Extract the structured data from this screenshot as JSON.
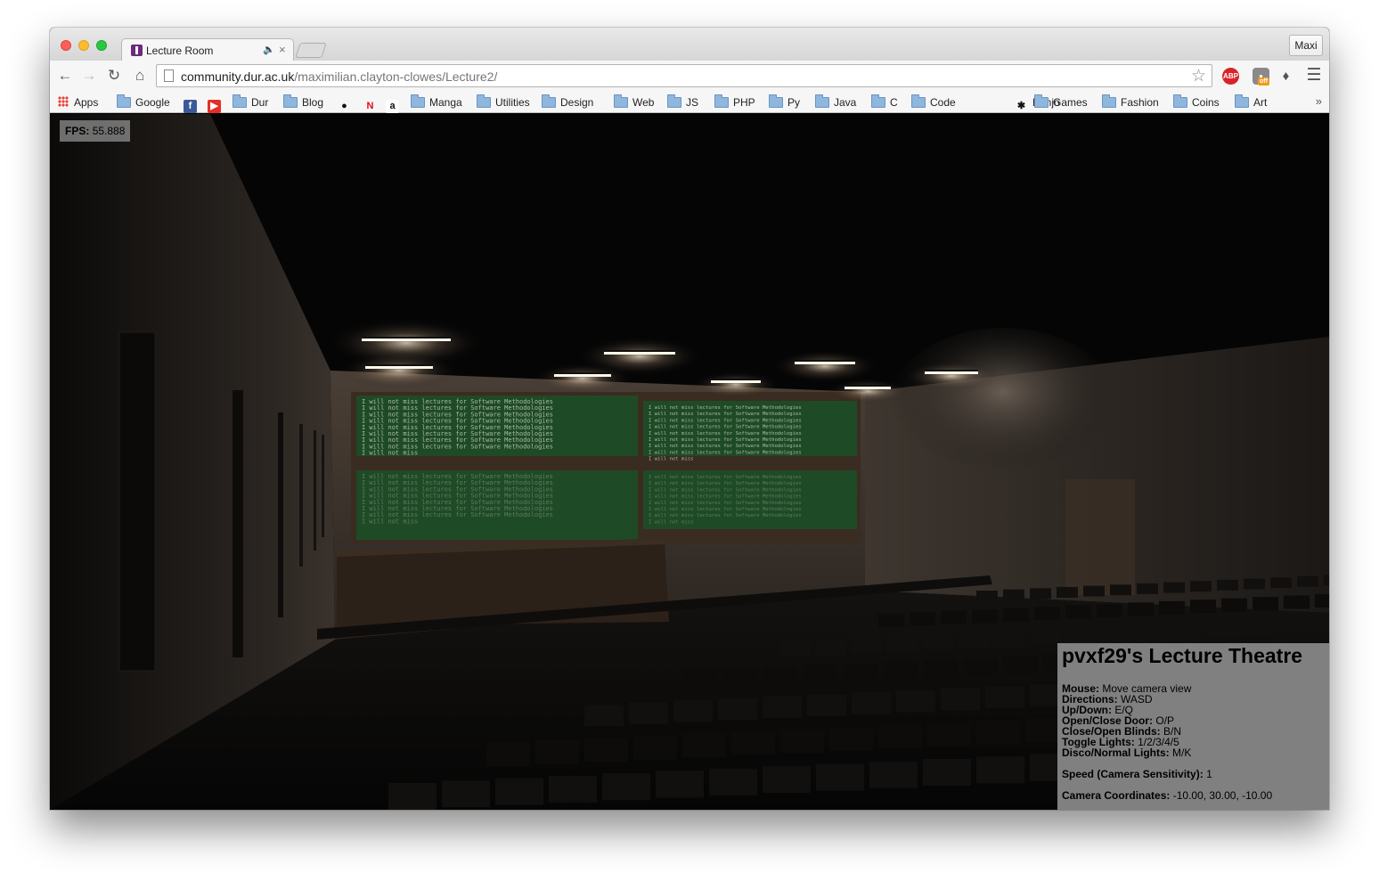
{
  "browser": {
    "tab_title": "Lecture Room",
    "profile_label": "Maxi",
    "url_host": "community.dur.ac.uk",
    "url_path": "/maximilian.clayton-clowes/Lecture2/"
  },
  "bookmarks": [
    {
      "label": "Apps",
      "icon": "apps-icon"
    },
    {
      "label": "Google",
      "icon": "folder-icon"
    },
    {
      "label": "",
      "icon": "facebook-icon"
    },
    {
      "label": "",
      "icon": "youtube-icon"
    },
    {
      "label": "Dur",
      "icon": "folder-icon"
    },
    {
      "label": "Blog",
      "icon": "folder-icon"
    },
    {
      "label": "",
      "icon": "github-icon"
    },
    {
      "label": "",
      "icon": "netflix-icon"
    },
    {
      "label": "",
      "icon": "amazon-icon"
    },
    {
      "label": "Manga",
      "icon": "folder-icon"
    },
    {
      "label": "Utilities",
      "icon": "folder-icon"
    },
    {
      "label": "Design",
      "icon": "folder-icon"
    },
    {
      "label": "Web",
      "icon": "folder-icon"
    },
    {
      "label": "JS",
      "icon": "folder-icon"
    },
    {
      "label": "PHP",
      "icon": "folder-icon"
    },
    {
      "label": "Py",
      "icon": "folder-icon"
    },
    {
      "label": "Java",
      "icon": "folder-icon"
    },
    {
      "label": "C",
      "icon": "folder-icon"
    },
    {
      "label": "Code",
      "icon": "folder-icon"
    },
    {
      "label": "Banjo",
      "icon": "banjo-icon"
    },
    {
      "label": "Games",
      "icon": "folder-icon"
    },
    {
      "label": "Fashion",
      "icon": "folder-icon"
    },
    {
      "label": "Coins",
      "icon": "folder-icon"
    },
    {
      "label": "Art",
      "icon": "folder-icon"
    }
  ],
  "bookmarks_overflow": "»",
  "fps": {
    "label": "FPS:",
    "value": "55.888"
  },
  "scene": {
    "blackboard_text": "I will not miss lectures for Software Methodologies",
    "blackboard_last_line": "I will not miss"
  },
  "info": {
    "title": "pvxf29's Lecture Theatre",
    "controls": [
      {
        "key": "Mouse:",
        "value": "Move camera view"
      },
      {
        "key": "Directions:",
        "value": "WASD"
      },
      {
        "key": "Up/Down:",
        "value": "E/Q"
      },
      {
        "key": "Open/Close Door:",
        "value": "O/P"
      },
      {
        "key": "Close/Open Blinds:",
        "value": "B/N"
      },
      {
        "key": "Toggle Lights:",
        "value": "1/2/3/4/5"
      },
      {
        "key": "Disco/Normal Lights:",
        "value": "M/K"
      }
    ],
    "speed": {
      "key": "Speed (Camera Sensitivity):",
      "value": "1"
    },
    "camera": {
      "key": "Camera Coordinates:",
      "value": "-10.00, 30.00, -10.00"
    }
  },
  "colors": {
    "blackboard": "#1f4a26",
    "chalk": "#c9d6c9",
    "light_glow": "#fff3da",
    "panel": "#808080"
  }
}
